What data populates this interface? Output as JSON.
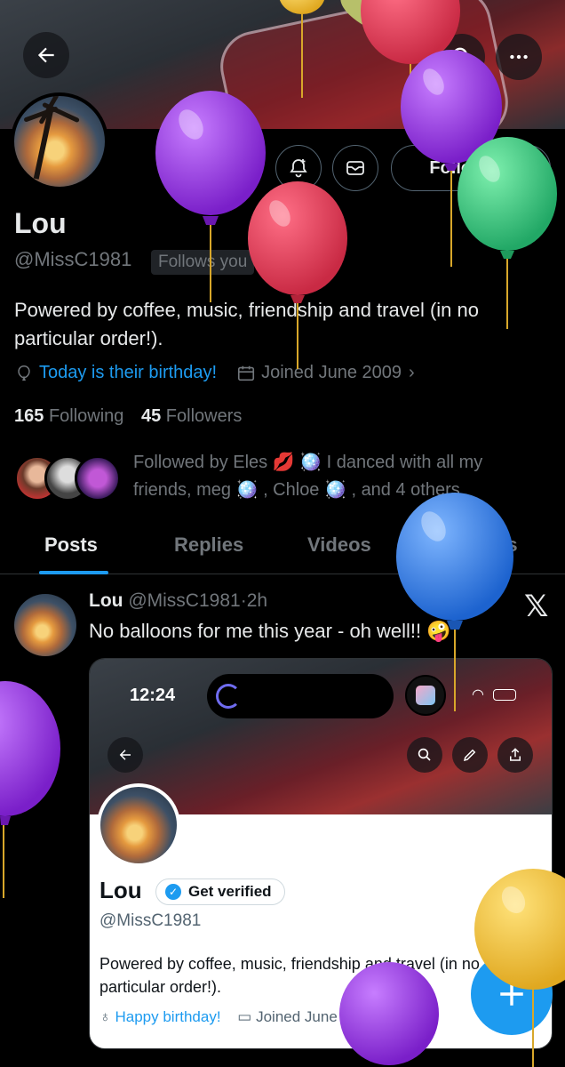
{
  "header": {
    "back_icon": "arrow-left-icon",
    "search_icon": "search-icon",
    "more_icon": "more-icon"
  },
  "profile": {
    "name": "Lou",
    "handle": "@MissC1981",
    "follows_you": "Follows you",
    "following_label": "Following",
    "bio": "Powered by coffee, music, friendship and travel (in no particular order!).",
    "birthday": "Today is their birthday!",
    "joined": "Joined June 2009",
    "following_count": "165",
    "following_label_stat": "Following",
    "followers_count": "45",
    "followers_label_stat": "Followers",
    "followed_by": "Followed by Eles 💋 🪩 I danced with all my friends, meg 🪩 , Chloe 🪩 , and 4 others"
  },
  "tabs": [
    "Posts",
    "Replies",
    "Videos",
    "Photos"
  ],
  "post": {
    "author": "Lou",
    "handle": "@MissC1981",
    "time": "2h",
    "text": "No balloons for me this year - oh well!! 🤪"
  },
  "embed": {
    "time": "12:24",
    "name": "Lou",
    "verified_label": "Get verified",
    "handle": "@MissC1981",
    "bio": "Powered by coffee, music, friendship and travel (in no particular order!).",
    "birthday": "Happy birthday!",
    "joined": "Joined June 2009"
  },
  "colors": {
    "accent": "#1d9bf0",
    "background": "#000000",
    "balloon_purple": "#8a2be2",
    "balloon_red": "#e0394f",
    "balloon_green": "#3ccf7e",
    "balloon_blue": "#2f7fe6",
    "balloon_yellow": "#f2c94c"
  }
}
